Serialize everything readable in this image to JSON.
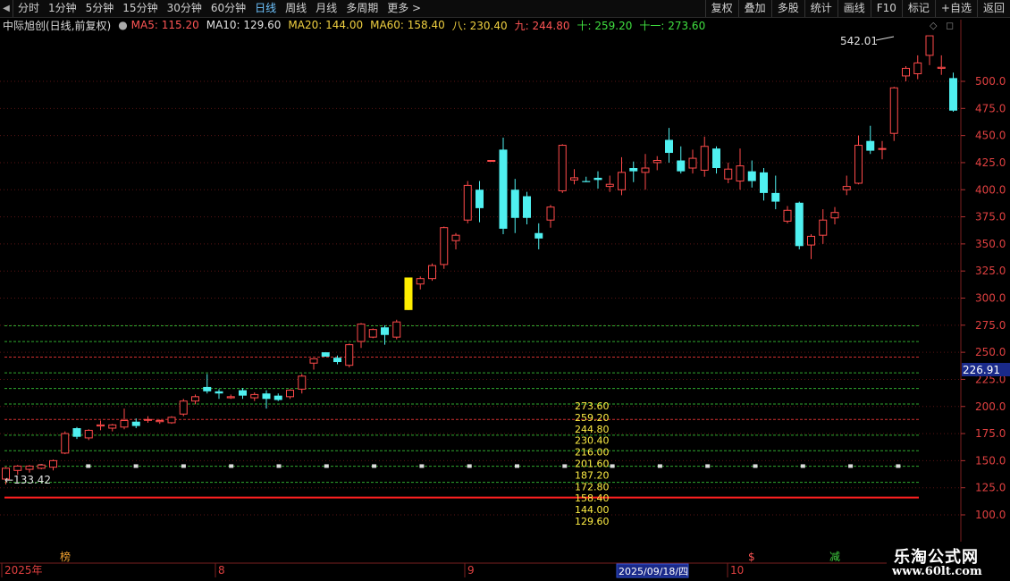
{
  "toolbar": {
    "collapse_icon": "chevron-left",
    "periods": [
      "分时",
      "1分钟",
      "5分钟",
      "15分钟",
      "30分钟",
      "60分钟",
      "日线",
      "周线",
      "月线",
      "多周期",
      "更多 >"
    ],
    "active_period": "日线",
    "right_buttons": [
      "复权",
      "叠加",
      "多股",
      "统计",
      "画线",
      "F10",
      "标记",
      "+自选",
      "返回"
    ]
  },
  "info": {
    "title": "中际旭创(日线,前复权)",
    "ma5": "MA5: 115.20",
    "ma10": "MA10: 129.60",
    "ma20": "MA20: 144.00",
    "ma60": "MA60: 158.40",
    "ba": "八: 230.40",
    "jiu": "九: 244.80",
    "shi": "十: 259.20",
    "shiyi": "十一: 273.60"
  },
  "colors": {
    "up": "#ff4a4a",
    "down": "#4ff0f0",
    "grid": "#5a1414",
    "axis_text": "#e04040",
    "hline_green": "#2fa82f",
    "hline_red": "#d03030",
    "level_text": "#ffee44",
    "highlight": "#ffee00",
    "base_line": "#ff2020"
  },
  "chart_data": {
    "type": "candlestick",
    "y_ticks": [
      500,
      475,
      450,
      425,
      400,
      375,
      350,
      325,
      300,
      275,
      250,
      225,
      200,
      175,
      150,
      125,
      100
    ],
    "ylim": [
      90,
      550
    ],
    "current_price_label": "226.91",
    "high_label": "542.01",
    "low_label": "133.42",
    "levels": [
      "273.60",
      "259.20",
      "244.80",
      "230.40",
      "216.00",
      "201.60",
      "187.20",
      "172.80",
      "158.40",
      "144.00",
      "129.60"
    ],
    "level_lines": [
      {
        "value": 274.4,
        "color": "green"
      },
      {
        "value": 259.9,
        "color": "green"
      },
      {
        "value": 245.6,
        "color": "red"
      },
      {
        "value": 231.0,
        "color": "green"
      },
      {
        "value": 216.6,
        "color": "green"
      },
      {
        "value": 202.3,
        "color": "green"
      },
      {
        "value": 188.0,
        "color": "red"
      },
      {
        "value": 173.5,
        "color": "green"
      },
      {
        "value": 159.2,
        "color": "green"
      },
      {
        "value": 144.8,
        "color": "green"
      },
      {
        "value": 130.0,
        "color": "green"
      }
    ],
    "base_line_value": 116,
    "candles": [
      [
        133,
        143,
        128,
        144
      ],
      [
        141,
        145,
        137,
        146
      ],
      [
        142,
        145,
        139,
        146
      ],
      [
        143,
        146,
        142,
        147
      ],
      [
        144,
        150,
        141,
        151
      ],
      [
        157,
        175,
        156,
        177
      ],
      [
        180,
        172,
        170,
        181
      ],
      [
        171,
        178,
        169,
        179
      ],
      [
        182,
        183,
        178,
        187
      ],
      [
        180,
        183,
        177,
        184
      ],
      [
        181,
        187,
        179,
        198
      ],
      [
        186,
        182,
        180,
        189
      ],
      [
        188,
        188,
        185,
        191
      ],
      [
        186,
        187,
        184,
        188
      ],
      [
        185,
        190,
        184,
        191
      ],
      [
        193,
        205,
        191,
        207
      ],
      [
        205,
        209,
        202,
        211
      ],
      [
        218,
        214,
        212,
        230
      ],
      [
        214,
        212,
        207,
        216
      ],
      [
        208,
        209,
        207,
        211
      ],
      [
        215,
        210,
        207,
        217
      ],
      [
        208,
        211,
        205,
        213
      ],
      [
        212,
        207,
        198,
        215
      ],
      [
        210,
        206,
        205,
        212
      ],
      [
        209,
        215,
        207,
        216
      ],
      [
        216,
        228,
        212,
        230
      ],
      [
        240,
        244,
        234,
        244
      ],
      [
        250,
        246,
        246,
        247
      ],
      [
        245,
        241,
        239,
        247
      ],
      [
        238,
        257,
        236,
        258
      ],
      [
        260,
        276,
        254,
        277
      ],
      [
        264,
        271,
        263,
        272
      ],
      [
        273,
        266,
        257,
        275
      ],
      [
        264,
        278,
        262,
        280
      ],
      [
        319,
        289,
        289,
        319
      ],
      [
        313,
        318,
        308,
        320
      ],
      [
        318,
        330,
        316,
        332
      ],
      [
        331,
        365,
        327,
        366
      ],
      [
        353,
        358,
        345,
        360
      ],
      [
        372,
        404,
        369,
        408
      ],
      [
        400,
        383,
        370,
        408
      ],
      [
        427,
        427,
        427,
        427
      ],
      [
        437,
        364,
        359,
        448
      ],
      [
        400,
        374,
        360,
        410
      ],
      [
        394,
        374,
        368,
        398
      ],
      [
        360,
        355,
        345,
        369
      ],
      [
        372,
        384,
        365,
        386
      ],
      [
        399,
        441,
        397,
        442
      ],
      [
        409,
        411,
        405,
        419
      ],
      [
        408,
        407,
        407,
        412
      ],
      [
        411,
        409,
        401,
        417
      ],
      [
        403,
        405,
        398,
        413
      ],
      [
        400,
        416,
        395,
        430
      ],
      [
        420,
        417,
        407,
        426
      ],
      [
        416,
        420,
        400,
        433
      ],
      [
        425,
        427,
        418,
        431
      ],
      [
        446,
        434,
        425,
        457
      ],
      [
        427,
        417,
        415,
        440
      ],
      [
        420,
        429,
        415,
        437
      ],
      [
        418,
        440,
        412,
        449
      ],
      [
        438,
        420,
        415,
        440
      ],
      [
        410,
        419,
        406,
        425
      ],
      [
        408,
        422,
        400,
        438
      ],
      [
        417,
        408,
        402,
        427
      ],
      [
        416,
        397,
        390,
        420
      ],
      [
        397,
        389,
        382,
        413
      ],
      [
        371,
        381,
        369,
        385
      ],
      [
        388,
        348,
        345,
        389
      ],
      [
        349,
        357,
        336,
        359
      ],
      [
        358,
        372,
        350,
        382
      ],
      [
        374,
        379,
        368,
        384
      ],
      [
        400,
        403,
        395,
        413
      ],
      [
        406,
        441,
        405,
        450
      ],
      [
        445,
        436,
        433,
        459
      ],
      [
        438,
        438,
        428,
        445
      ],
      [
        452,
        494,
        445,
        495
      ],
      [
        505,
        512,
        500,
        514
      ],
      [
        507,
        517,
        502,
        524
      ],
      [
        524,
        542,
        515,
        542
      ],
      [
        512,
        513,
        506,
        524
      ],
      [
        503,
        473,
        472,
        508
      ]
    ],
    "x_labels": [
      "2025年",
      "8",
      "9",
      "10"
    ],
    "cursor_date": "2025/09/18/四",
    "markers": [
      "榜",
      "$",
      "减"
    ]
  },
  "logo": {
    "line1": "乐淘公式网",
    "line2": "www.60lt.com"
  }
}
